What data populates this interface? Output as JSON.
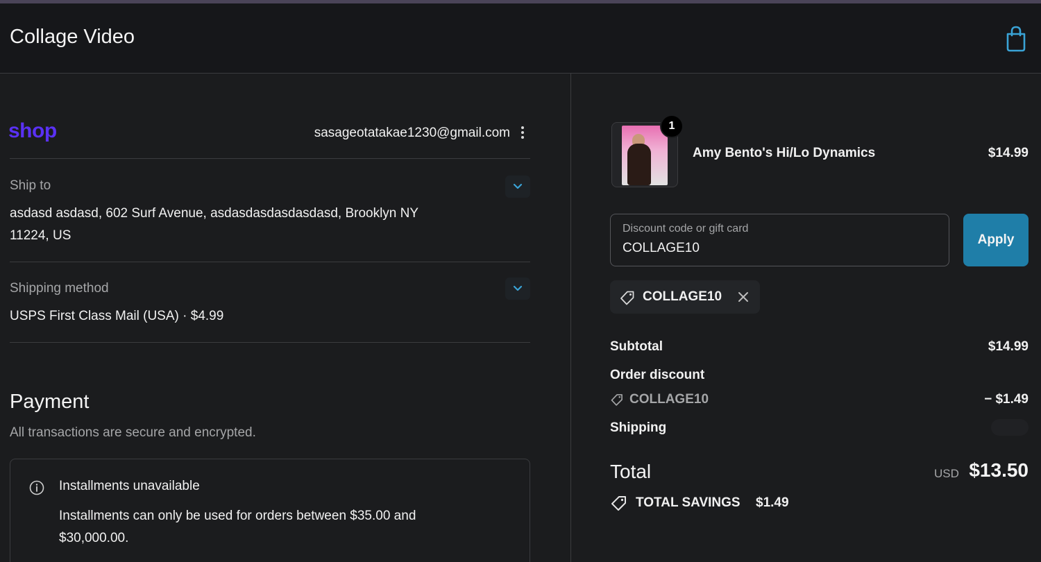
{
  "header": {
    "store_name": "Collage Video",
    "cart_icon": "shopping-bag-icon"
  },
  "account": {
    "shop_logo": "shop",
    "email": "sasageotatakae1230@gmail.com",
    "menu_icon": "kebab-menu-icon"
  },
  "ship_to": {
    "label": "Ship to",
    "address_line1": "asdasd asdasd, 602 Surf Avenue, asdasdasdasdasdasd, Brooklyn NY",
    "address_line2": "11224, US"
  },
  "shipping_method": {
    "label": "Shipping method",
    "value": "USPS First Class Mail (USA) · $4.99"
  },
  "payment": {
    "title": "Payment",
    "subtitle": "All transactions are secure and encrypted.",
    "notice_title": "Installments unavailable",
    "notice_body": "Installments can only be used for orders between $35.00 and $30,000.00."
  },
  "order": {
    "product": {
      "name": "Amy Bento's Hi/Lo Dynamics",
      "price": "$14.99",
      "quantity": "1"
    },
    "discount": {
      "label": "Discount code or gift card",
      "value": "COLLAGE10",
      "apply_label": "Apply",
      "applied_code": "COLLAGE10"
    },
    "summary": {
      "subtotal_label": "Subtotal",
      "subtotal_value": "$14.99",
      "discount_label": "Order discount",
      "discount_code": "COLLAGE10",
      "discount_value": "− $1.49",
      "shipping_label": "Shipping",
      "total_label": "Total",
      "currency": "USD",
      "total_value": "$13.50",
      "savings_label": "TOTAL SAVINGS",
      "savings_value": "$1.49"
    }
  },
  "colors": {
    "background": "#1b1c1e",
    "header": "#16171a",
    "accent": "#1f7ea8",
    "shop_brand": "#5a31f4"
  }
}
